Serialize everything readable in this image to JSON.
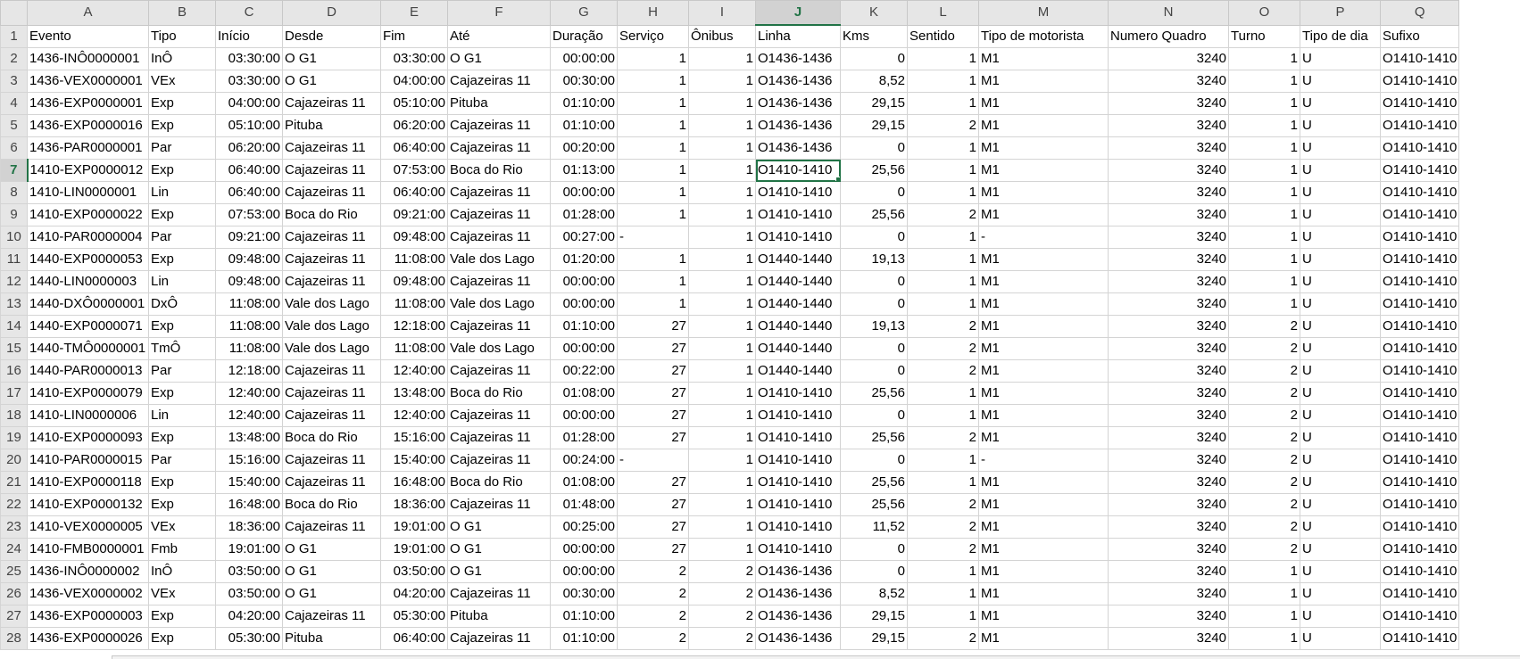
{
  "spreadsheet": {
    "active_cell": "J7",
    "column_letters": [
      "A",
      "B",
      "C",
      "D",
      "E",
      "F",
      "G",
      "H",
      "I",
      "J",
      "K",
      "L",
      "M",
      "N",
      "O",
      "P",
      "Q"
    ],
    "active_column": "J",
    "active_row": 7,
    "rows": [
      [
        "Evento",
        "Tipo",
        "Início",
        "Desde",
        "Fim",
        "Até",
        "Duração",
        "Serviço",
        "Ônibus",
        "Linha",
        "Kms",
        "Sentido",
        "Tipo de motorista",
        "Numero Quadro",
        "Turno",
        "Tipo de dia",
        "Sufixo"
      ],
      [
        "1436-INÔ0000001",
        "InÔ",
        "03:30:00",
        "O G1",
        "03:30:00",
        "O G1",
        "00:00:00",
        "1",
        "1",
        "O1436-1436",
        "0",
        "1",
        "M1",
        "3240",
        "1",
        "U",
        "O1410-1410"
      ],
      [
        "1436-VEX0000001",
        "VEx",
        "03:30:00",
        "O G1",
        "04:00:00",
        "Cajazeiras 11",
        "00:30:00",
        "1",
        "1",
        "O1436-1436",
        "8,52",
        "1",
        "M1",
        "3240",
        "1",
        "U",
        "O1410-1410"
      ],
      [
        "1436-EXP0000001",
        "Exp",
        "04:00:00",
        "Cajazeiras 11",
        "05:10:00",
        "Pituba",
        "01:10:00",
        "1",
        "1",
        "O1436-1436",
        "29,15",
        "1",
        "M1",
        "3240",
        "1",
        "U",
        "O1410-1410"
      ],
      [
        "1436-EXP0000016",
        "Exp",
        "05:10:00",
        "Pituba",
        "06:20:00",
        "Cajazeiras 11",
        "01:10:00",
        "1",
        "1",
        "O1436-1436",
        "29,15",
        "2",
        "M1",
        "3240",
        "1",
        "U",
        "O1410-1410"
      ],
      [
        "1436-PAR0000001",
        "Par",
        "06:20:00",
        "Cajazeiras 11",
        "06:40:00",
        "Cajazeiras 11",
        "00:20:00",
        "1",
        "1",
        "O1436-1436",
        "0",
        "1",
        "M1",
        "3240",
        "1",
        "U",
        "O1410-1410"
      ],
      [
        "1410-EXP0000012",
        "Exp",
        "06:40:00",
        "Cajazeiras 11",
        "07:53:00",
        "Boca do Rio",
        "01:13:00",
        "1",
        "1",
        "O1410-1410",
        "25,56",
        "1",
        "M1",
        "3240",
        "1",
        "U",
        "O1410-1410"
      ],
      [
        "1410-LIN0000001",
        "Lin",
        "06:40:00",
        "Cajazeiras 11",
        "06:40:00",
        "Cajazeiras 11",
        "00:00:00",
        "1",
        "1",
        "O1410-1410",
        "0",
        "1",
        "M1",
        "3240",
        "1",
        "U",
        "O1410-1410"
      ],
      [
        "1410-EXP0000022",
        "Exp",
        "07:53:00",
        "Boca do Rio",
        "09:21:00",
        "Cajazeiras 11",
        "01:28:00",
        "1",
        "1",
        "O1410-1410",
        "25,56",
        "2",
        "M1",
        "3240",
        "1",
        "U",
        "O1410-1410"
      ],
      [
        "1410-PAR0000004",
        "Par",
        "09:21:00",
        "Cajazeiras 11",
        "09:48:00",
        "Cajazeiras 11",
        "00:27:00",
        "-",
        "1",
        "O1410-1410",
        "0",
        "1",
        "-",
        "3240",
        "1",
        "U",
        "O1410-1410"
      ],
      [
        "1440-EXP0000053",
        "Exp",
        "09:48:00",
        "Cajazeiras 11",
        "11:08:00",
        "Vale dos Lago",
        "01:20:00",
        "1",
        "1",
        "O1440-1440",
        "19,13",
        "1",
        "M1",
        "3240",
        "1",
        "U",
        "O1410-1410"
      ],
      [
        "1440-LIN0000003",
        "Lin",
        "09:48:00",
        "Cajazeiras 11",
        "09:48:00",
        "Cajazeiras 11",
        "00:00:00",
        "1",
        "1",
        "O1440-1440",
        "0",
        "1",
        "M1",
        "3240",
        "1",
        "U",
        "O1410-1410"
      ],
      [
        "1440-DXÔ0000001",
        "DxÔ",
        "11:08:00",
        "Vale dos Lago",
        "11:08:00",
        "Vale dos Lago",
        "00:00:00",
        "1",
        "1",
        "O1440-1440",
        "0",
        "1",
        "M1",
        "3240",
        "1",
        "U",
        "O1410-1410"
      ],
      [
        "1440-EXP0000071",
        "Exp",
        "11:08:00",
        "Vale dos Lago",
        "12:18:00",
        "Cajazeiras 11",
        "01:10:00",
        "27",
        "1",
        "O1440-1440",
        "19,13",
        "2",
        "M1",
        "3240",
        "2",
        "U",
        "O1410-1410"
      ],
      [
        "1440-TMÔ0000001",
        "TmÔ",
        "11:08:00",
        "Vale dos Lago",
        "11:08:00",
        "Vale dos Lago",
        "00:00:00",
        "27",
        "1",
        "O1440-1440",
        "0",
        "2",
        "M1",
        "3240",
        "2",
        "U",
        "O1410-1410"
      ],
      [
        "1440-PAR0000013",
        "Par",
        "12:18:00",
        "Cajazeiras 11",
        "12:40:00",
        "Cajazeiras 11",
        "00:22:00",
        "27",
        "1",
        "O1440-1440",
        "0",
        "2",
        "M1",
        "3240",
        "2",
        "U",
        "O1410-1410"
      ],
      [
        "1410-EXP0000079",
        "Exp",
        "12:40:00",
        "Cajazeiras 11",
        "13:48:00",
        "Boca do Rio",
        "01:08:00",
        "27",
        "1",
        "O1410-1410",
        "25,56",
        "1",
        "M1",
        "3240",
        "2",
        "U",
        "O1410-1410"
      ],
      [
        "1410-LIN0000006",
        "Lin",
        "12:40:00",
        "Cajazeiras 11",
        "12:40:00",
        "Cajazeiras 11",
        "00:00:00",
        "27",
        "1",
        "O1410-1410",
        "0",
        "1",
        "M1",
        "3240",
        "2",
        "U",
        "O1410-1410"
      ],
      [
        "1410-EXP0000093",
        "Exp",
        "13:48:00",
        "Boca do Rio",
        "15:16:00",
        "Cajazeiras 11",
        "01:28:00",
        "27",
        "1",
        "O1410-1410",
        "25,56",
        "2",
        "M1",
        "3240",
        "2",
        "U",
        "O1410-1410"
      ],
      [
        "1410-PAR0000015",
        "Par",
        "15:16:00",
        "Cajazeiras 11",
        "15:40:00",
        "Cajazeiras 11",
        "00:24:00",
        "-",
        "1",
        "O1410-1410",
        "0",
        "1",
        "-",
        "3240",
        "2",
        "U",
        "O1410-1410"
      ],
      [
        "1410-EXP0000118",
        "Exp",
        "15:40:00",
        "Cajazeiras 11",
        "16:48:00",
        "Boca do Rio",
        "01:08:00",
        "27",
        "1",
        "O1410-1410",
        "25,56",
        "1",
        "M1",
        "3240",
        "2",
        "U",
        "O1410-1410"
      ],
      [
        "1410-EXP0000132",
        "Exp",
        "16:48:00",
        "Boca do Rio",
        "18:36:00",
        "Cajazeiras 11",
        "01:48:00",
        "27",
        "1",
        "O1410-1410",
        "25,56",
        "2",
        "M1",
        "3240",
        "2",
        "U",
        "O1410-1410"
      ],
      [
        "1410-VEX0000005",
        "VEx",
        "18:36:00",
        "Cajazeiras 11",
        "19:01:00",
        "O G1",
        "00:25:00",
        "27",
        "1",
        "O1410-1410",
        "11,52",
        "2",
        "M1",
        "3240",
        "2",
        "U",
        "O1410-1410"
      ],
      [
        "1410-FMB0000001",
        "Fmb",
        "19:01:00",
        "O G1",
        "19:01:00",
        "O G1",
        "00:00:00",
        "27",
        "1",
        "O1410-1410",
        "0",
        "2",
        "M1",
        "3240",
        "2",
        "U",
        "O1410-1410"
      ],
      [
        "1436-INÔ0000002",
        "InÔ",
        "03:50:00",
        "O G1",
        "03:50:00",
        "O G1",
        "00:00:00",
        "2",
        "2",
        "O1436-1436",
        "0",
        "1",
        "M1",
        "3240",
        "1",
        "U",
        "O1410-1410"
      ],
      [
        "1436-VEX0000002",
        "VEx",
        "03:50:00",
        "O G1",
        "04:20:00",
        "Cajazeiras 11",
        "00:30:00",
        "2",
        "2",
        "O1436-1436",
        "8,52",
        "1",
        "M1",
        "3240",
        "1",
        "U",
        "O1410-1410"
      ],
      [
        "1436-EXP0000003",
        "Exp",
        "04:20:00",
        "Cajazeiras 11",
        "05:30:00",
        "Pituba",
        "01:10:00",
        "2",
        "2",
        "O1436-1436",
        "29,15",
        "1",
        "M1",
        "3240",
        "1",
        "U",
        "O1410-1410"
      ],
      [
        "1436-EXP0000026",
        "Exp",
        "05:30:00",
        "Pituba",
        "06:40:00",
        "Cajazeiras 11",
        "01:10:00",
        "2",
        "2",
        "O1436-1436",
        "29,15",
        "2",
        "M1",
        "3240",
        "1",
        "U",
        "O1410-1410"
      ]
    ]
  }
}
